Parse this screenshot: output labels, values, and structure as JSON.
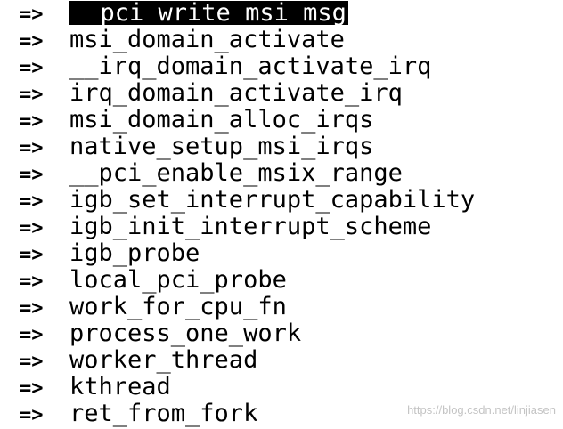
{
  "arrow": "=>",
  "selected_color": "#000000",
  "selected_text_color": "#ffffff",
  "trace": [
    {
      "fn": "__pci_write_msi_msg",
      "selected": true
    },
    {
      "fn": "msi_domain_activate",
      "selected": false
    },
    {
      "fn": "__irq_domain_activate_irq",
      "selected": false
    },
    {
      "fn": "irq_domain_activate_irq",
      "selected": false
    },
    {
      "fn": "msi_domain_alloc_irqs",
      "selected": false
    },
    {
      "fn": "native_setup_msi_irqs",
      "selected": false
    },
    {
      "fn": "__pci_enable_msix_range",
      "selected": false
    },
    {
      "fn": "igb_set_interrupt_capability",
      "selected": false
    },
    {
      "fn": "igb_init_interrupt_scheme",
      "selected": false
    },
    {
      "fn": "igb_probe",
      "selected": false
    },
    {
      "fn": "local_pci_probe",
      "selected": false
    },
    {
      "fn": "work_for_cpu_fn",
      "selected": false
    },
    {
      "fn": "process_one_work",
      "selected": false
    },
    {
      "fn": "worker_thread",
      "selected": false
    },
    {
      "fn": "kthread",
      "selected": false
    },
    {
      "fn": "ret_from_fork",
      "selected": false
    }
  ],
  "watermark": "https://blog.csdn.net/linjiasen"
}
